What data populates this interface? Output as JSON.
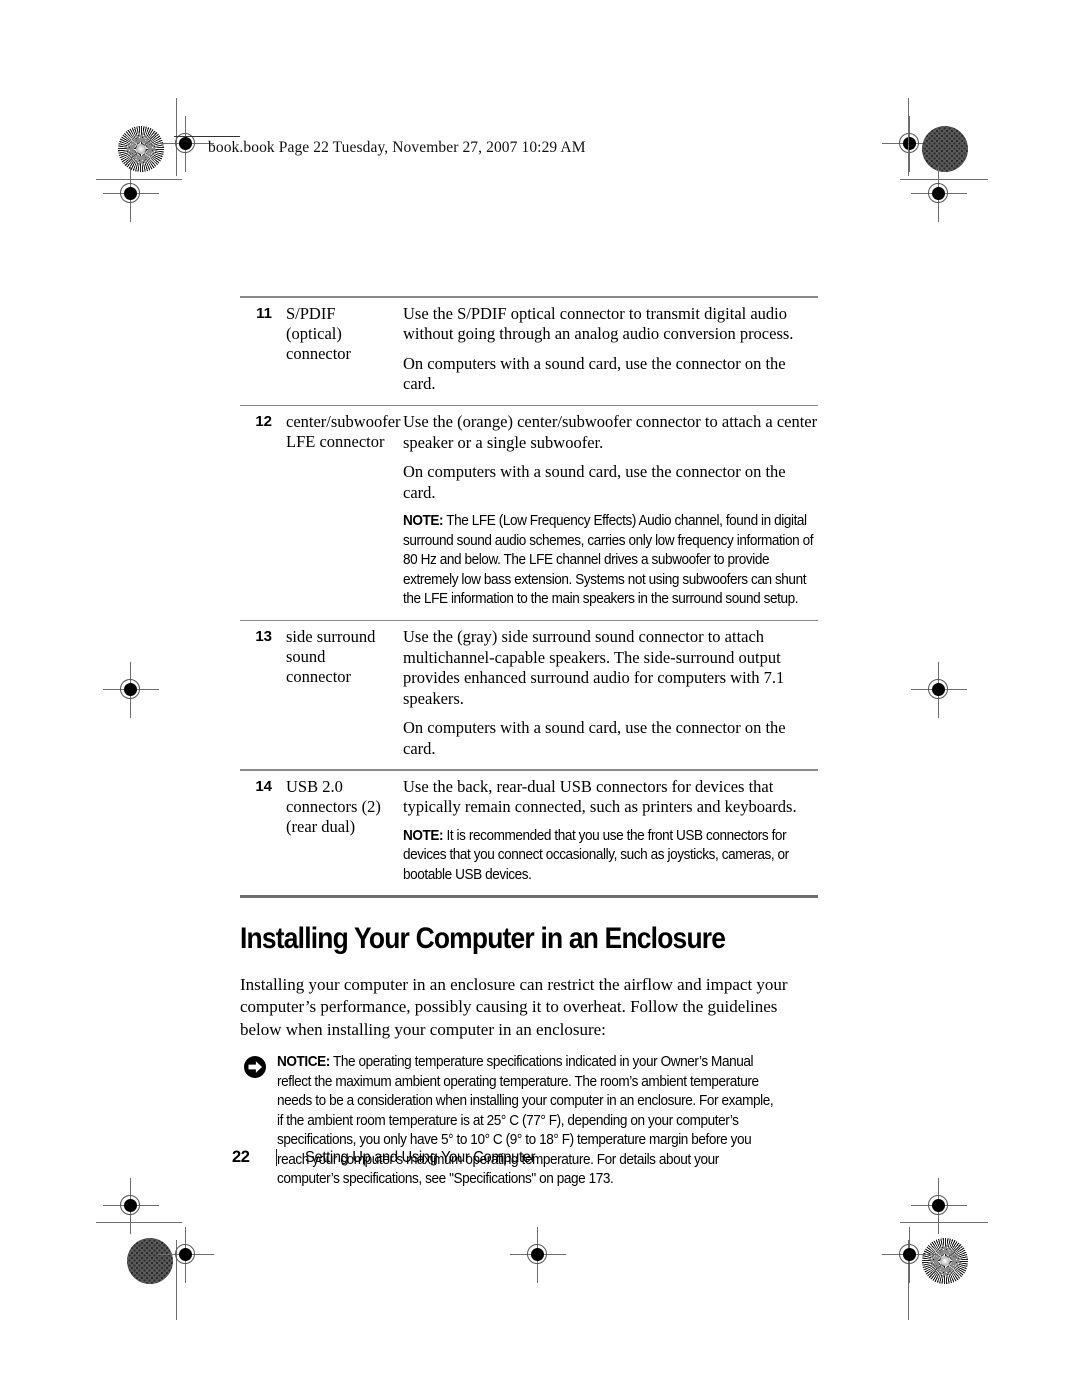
{
  "page": {
    "header_slug": "book.book  Page 22  Tuesday, November 27, 2007  10:29 AM",
    "footer_page_number": "22",
    "footer_title": "Setting Up and Using Your Computer"
  },
  "spec_table": {
    "rows": [
      {
        "number": "11",
        "label": "S/PDIF (optical) connector",
        "paragraphs": [
          "Use the S/PDIF optical connector to transmit digital audio without going through an analog audio conversion process.",
          "On computers with a sound card, use the connector on the card."
        ],
        "note": null
      },
      {
        "number": "12",
        "label": "center/subwoofer LFE connector",
        "paragraphs": [
          "Use the (orange) center/subwoofer connector to attach a center speaker or a single subwoofer.",
          "On computers with a sound card, use the connector on the card."
        ],
        "note": {
          "lead": "NOTE:",
          "text": " The LFE (Low Frequency Effects) Audio channel, found in digital surround sound audio schemes, carries only low frequency information of 80 Hz and below. The LFE channel drives a subwoofer to provide extremely low bass extension. Systems not using subwoofers can shunt the LFE information to the main speakers in the surround sound setup."
        }
      },
      {
        "number": "13",
        "label": "side surround sound connector",
        "paragraphs": [
          "Use the (gray) side surround sound connector to attach multichannel-capable speakers. The side-surround output provides enhanced surround audio for computers with 7.1 speakers.",
          "On computers with a sound card, use the connector on the card."
        ],
        "note": null
      },
      {
        "number": "14",
        "label": "USB 2.0 connectors (2) (rear dual)",
        "paragraphs": [
          "Use the back, rear-dual USB connectors for devices that typically remain connected, such as printers and keyboards."
        ],
        "note": {
          "lead": "NOTE:",
          "text": " It is recommended that you use the front USB connectors for devices that you connect occasionally, such as joysticks, cameras, or bootable USB devices."
        }
      }
    ]
  },
  "section": {
    "heading": "Installing Your Computer in an Enclosure",
    "intro": "Installing your computer in an enclosure can restrict the airflow and impact your computer’s performance, possibly causing it to overheat. Follow the guidelines below when installing your computer in an enclosure:",
    "notice": {
      "icon": "notice-arrow-icon",
      "lead": "NOTICE:",
      "text": " The operating temperature specifications indicated in your Owner’s Manual reflect the maximum ambient operating temperature. The room’s ambient temperature needs to be a consideration when installing your computer in an enclosure. For example, if the ambient room temperature is at 25° C (77° F), depending on your computer’s specifications, you only have 5° to 10° C (9° to 18° F) temperature margin before you reach your computer’s maximum operating temperature. For details about your computer’s specifications, see \"Specifications\" on page 173."
    }
  },
  "print_marks": {
    "star_target": "star-registration-target",
    "halftone_target": "halftone-registration-target",
    "crosshair": "crosshair-registration-mark"
  }
}
